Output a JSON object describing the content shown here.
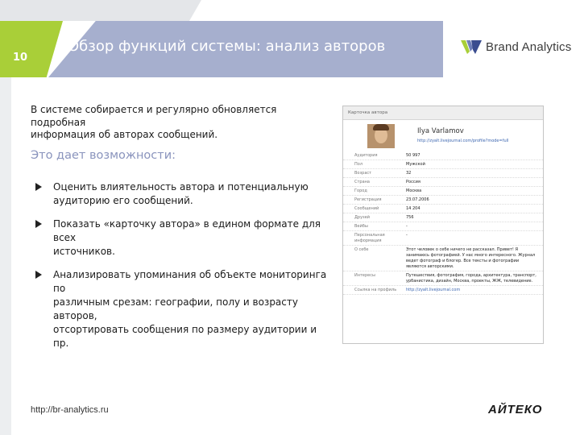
{
  "slide": {
    "number": "10",
    "title": "Обзор функций системы: анализ авторов"
  },
  "logo": {
    "brand_text": "Brand Analytics"
  },
  "intro": {
    "line1": "В системе собирается и регулярно обновляется подробная",
    "line2": "информация об авторах сообщений."
  },
  "heading": "Это дает возможности:",
  "bullets": [
    {
      "line1": "Оценить влиятельность автора и потенциальную",
      "line2": "аудиторию его сообщений."
    },
    {
      "line1": "Показать «карточку автора» в едином формате для всех",
      "line2": "источников."
    },
    {
      "line1": "Анализировать упоминания об объекте мониторинга по",
      "line2": "различным срезам: географии, полу и возрасту авторов,",
      "line3": "отсортировать сообщения по размеру аудитории и пр."
    }
  ],
  "card": {
    "header": "Карточка автора",
    "name": "Ilya Varlamov",
    "url": "http://zyalt.livejournal.com/profile?mode=full",
    "rows": [
      {
        "label": "Аудитория",
        "value": "50 997"
      },
      {
        "label": "Пол",
        "value": "Мужской"
      },
      {
        "label": "Возраст",
        "value": "32"
      },
      {
        "label": "Страна",
        "value": "Россия"
      },
      {
        "label": "Город",
        "value": "Москва"
      },
      {
        "label": "Регистрация",
        "value": "23.07.2006"
      },
      {
        "label": "Сообщений",
        "value": "14 204"
      },
      {
        "label": "Друзей",
        "value": "756"
      },
      {
        "label": "Вейбы",
        "value": "-"
      },
      {
        "label": "Персональная информация",
        "value": "-"
      },
      {
        "label": "О себе",
        "value": "Этот человек о себе ничего не рассказал. Привет! Я занимаюсь фотографией. У нас много интересного. Журнал ведет фотограф и блогер. Все тексты и фотографии являются авторскими."
      },
      {
        "label": "Интересы",
        "value": "Путешествия, фотография, города, архитектура, транспорт, урбанистика, дизайн, Москва, проекты, ЖЖ, телевидение."
      },
      {
        "label": "Ссылка на профиль",
        "value": "http://zyalt.livejournal.com"
      }
    ]
  },
  "footer": {
    "url": "http://br-analytics.ru",
    "company_logo": "АЙТЕКО"
  },
  "colors": {
    "green": "#a9cf38",
    "blue": "#a6afce",
    "heading": "#8a94bd"
  }
}
